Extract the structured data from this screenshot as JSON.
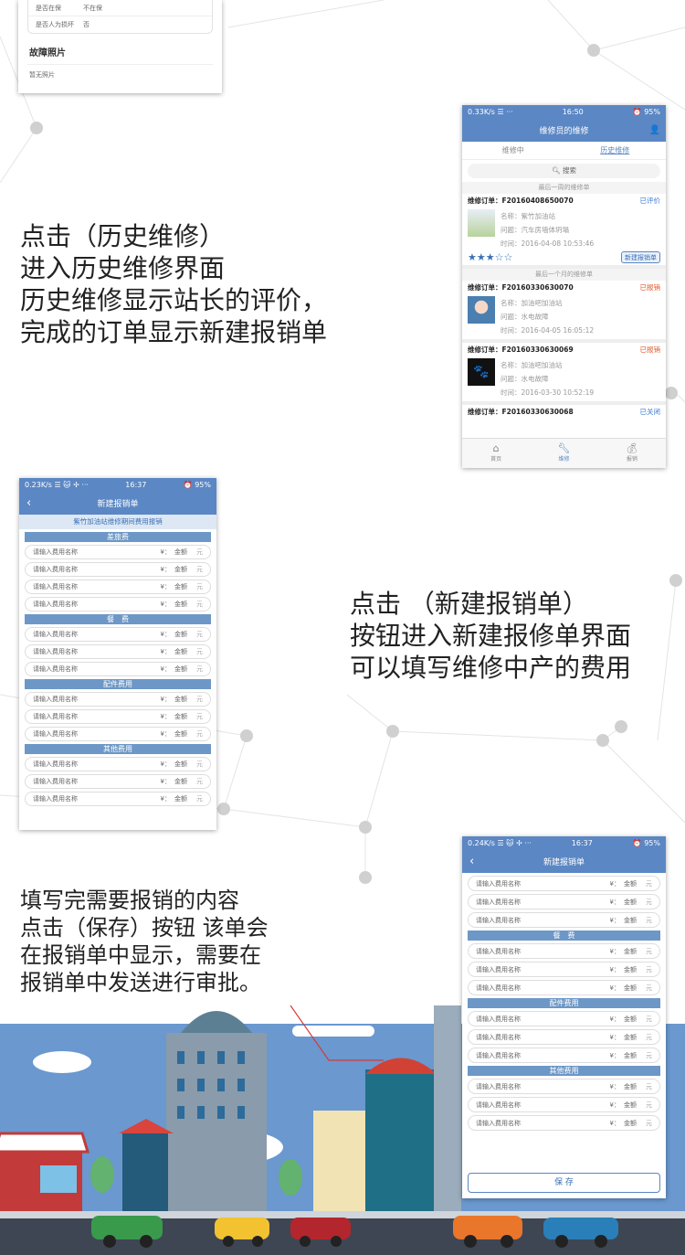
{
  "colors": {
    "blue": "#5b87c4",
    "sec": "#6d97c6",
    "sky": "#6a98cf",
    "ground": "#3e4653"
  },
  "top_card": {
    "rows": [
      {
        "k": "是否在保",
        "v": "不在保"
      },
      {
        "k": "是否人为损坏",
        "v": "否"
      }
    ],
    "heading": "故障照片",
    "note": "暂无照片"
  },
  "text1": [
    "点击（历史维修）",
    "进入历史维修界面",
    "历史维修显示站长的评价，",
    "完成的订单显示新建报销单"
  ],
  "text2": [
    "点击 （新建报销单）",
    "按钮进入新建报修单界面",
    "可以填写维修中产的费用"
  ],
  "text3": [
    "填写完需要报销的内容",
    "点击（保存）按钮 该单会",
    "在报销单中显示，需要在",
    "报销单中发送进行审批。"
  ],
  "history": {
    "status": {
      "left": "0.33K/s ☰ ···",
      "time": "16:50",
      "right": "⏰ 95%"
    },
    "title": "维修员的维修",
    "tabs": [
      "维修中",
      "历史维修"
    ],
    "search": "搜索",
    "group1": "最后一周的维修单",
    "group2": "最后一个月的维修单",
    "orders": [
      {
        "label": "维修订单：",
        "no": "F20160408650070",
        "status": "已评价",
        "name": "名称：紫竹加油站",
        "issue": "问题：汽车房墙体坍塌",
        "time": "时间：2016-04-08 10:53:46",
        "btn": "新建报销单",
        "stars": "★★★☆☆",
        "scolor": "#3a7bd5"
      },
      {
        "label": "维修订单：",
        "no": "F20160330630070",
        "status": "已报销",
        "name": "名称：加油吧加油站",
        "issue": "问题：水电故障",
        "time": "时间：2016-04-05 16:05:12",
        "scolor": "#e05a2b"
      },
      {
        "label": "维修订单：",
        "no": "F20160330630069",
        "status": "已报销",
        "name": "名称：加油吧加油站",
        "issue": "问题：水电故障",
        "time": "时间：2016-03-30 10:52:19",
        "scolor": "#e05a2b"
      },
      {
        "label": "维修订单：",
        "no": "F20160330630068",
        "status": "已关闭",
        "scolor": "#3a7bd5"
      }
    ],
    "bottom": [
      "首页",
      "维修",
      "报销"
    ]
  },
  "form1": {
    "status": {
      "left": "0.23K/s ☰ 🐱 ✢ ···",
      "time": "16:37",
      "right": "⏰ 95%"
    },
    "title": "新建报销单",
    "subtitle": "紫竹加油站维修期间费用报销",
    "sections": [
      {
        "name": "差旅费",
        "rows": 4
      },
      {
        "name": "餐　费",
        "rows": 3
      },
      {
        "name": "配件费用",
        "rows": 3
      },
      {
        "name": "其他费用",
        "rows": 3
      }
    ]
  },
  "form2": {
    "status": {
      "left": "0.24K/s ☰ 🐱 ✢ ···",
      "time": "16:37",
      "right": "⏰ 95%"
    },
    "title": "新建报销单",
    "lead": 3,
    "sections": [
      {
        "name": "餐　费",
        "rows": 3
      },
      {
        "name": "配件费用",
        "rows": 3
      },
      {
        "name": "其他费用",
        "rows": 3
      }
    ],
    "save": "保 存"
  },
  "field": {
    "placeholder": "请输入费用名称",
    "yen": "¥：",
    "amount": "金额",
    "unit": "元"
  }
}
